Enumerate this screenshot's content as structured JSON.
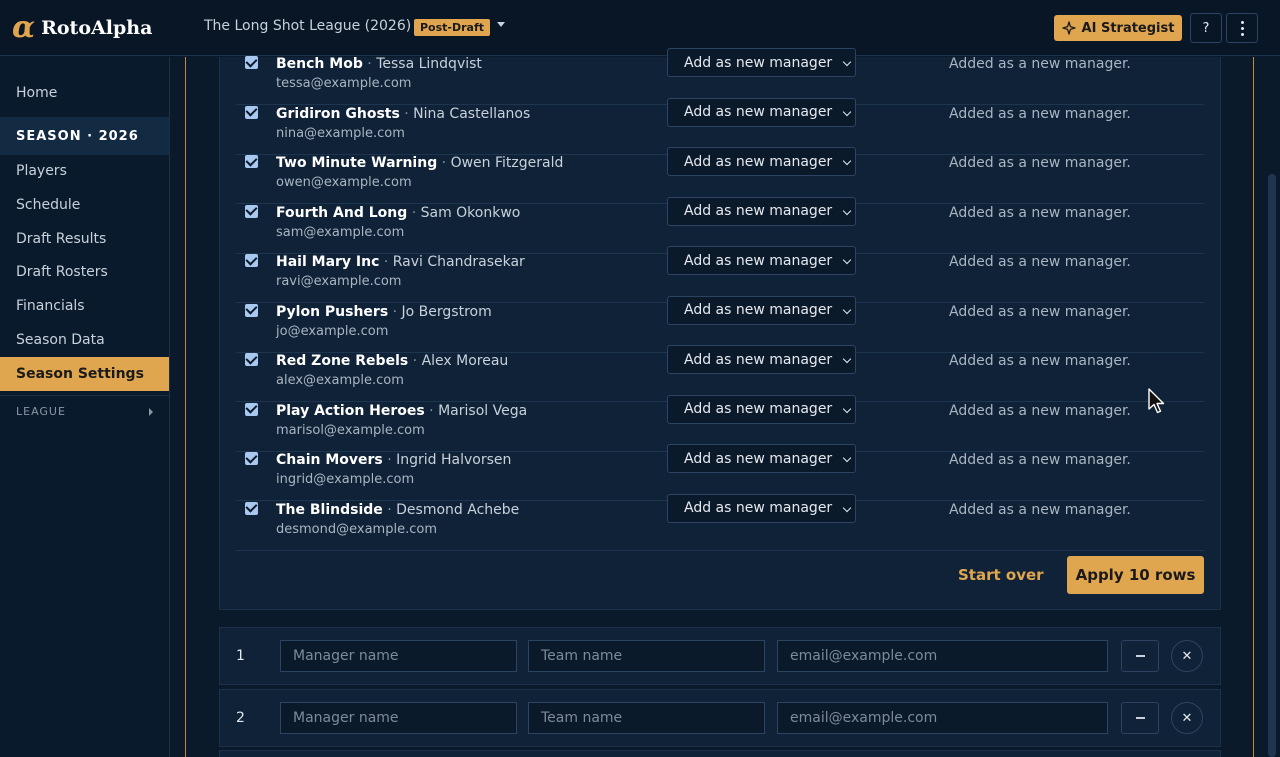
{
  "app": {
    "brand_mark": "α",
    "brand_name": "RotoAlpha"
  },
  "header": {
    "league_title": "The Long Shot League (2026)",
    "status_badge": "Post-Draft",
    "ai_button": "AI Strategist",
    "help_button": "?"
  },
  "sidebar": {
    "home": "Home",
    "season_heading": "SEASON · 2026",
    "items": [
      "Players",
      "Schedule",
      "Draft Results",
      "Draft Rosters",
      "Financials",
      "Season Data",
      "Season Settings"
    ],
    "active_item": "Season Settings",
    "league_heading": "LEAGUE"
  },
  "import_rows": [
    {
      "team": "Bench Mob",
      "manager": "Tessa Lindqvist",
      "email": "tessa@example.com",
      "action": "Add as new manager",
      "note": "Added as a new manager.",
      "checked": true
    },
    {
      "team": "Gridiron Ghosts",
      "manager": "Nina Castellanos",
      "email": "nina@example.com",
      "action": "Add as new manager",
      "note": "Added as a new manager.",
      "checked": true
    },
    {
      "team": "Two Minute Warning",
      "manager": "Owen Fitzgerald",
      "email": "owen@example.com",
      "action": "Add as new manager",
      "note": "Added as a new manager.",
      "checked": true
    },
    {
      "team": "Fourth And Long",
      "manager": "Sam Okonkwo",
      "email": "sam@example.com",
      "action": "Add as new manager",
      "note": "Added as a new manager.",
      "checked": true
    },
    {
      "team": "Hail Mary Inc",
      "manager": "Ravi Chandrasekar",
      "email": "ravi@example.com",
      "action": "Add as new manager",
      "note": "Added as a new manager.",
      "checked": true
    },
    {
      "team": "Pylon Pushers",
      "manager": "Jo Bergstrom",
      "email": "jo@example.com",
      "action": "Add as new manager",
      "note": "Added as a new manager.",
      "checked": true
    },
    {
      "team": "Red Zone Rebels",
      "manager": "Alex Moreau",
      "email": "alex@example.com",
      "action": "Add as new manager",
      "note": "Added as a new manager.",
      "checked": true
    },
    {
      "team": "Play Action Heroes",
      "manager": "Marisol Vega",
      "email": "marisol@example.com",
      "action": "Add as new manager",
      "note": "Added as a new manager.",
      "checked": true
    },
    {
      "team": "Chain Movers",
      "manager": "Ingrid Halvorsen",
      "email": "ingrid@example.com",
      "action": "Add as new manager",
      "note": "Added as a new manager.",
      "checked": true
    },
    {
      "team": "The Blindside",
      "manager": "Desmond Achebe",
      "email": "desmond@example.com",
      "action": "Add as new manager",
      "note": "Added as a new manager.",
      "checked": true
    }
  ],
  "import_actions": {
    "start_over": "Start over",
    "apply": "Apply 10 rows"
  },
  "manual_entries": [
    {
      "number": "1",
      "manager_placeholder": "Manager name",
      "team_placeholder": "Team name",
      "email_placeholder": "email@example.com"
    },
    {
      "number": "2",
      "manager_placeholder": "Manager name",
      "team_placeholder": "Team name",
      "email_placeholder": "email@example.com"
    }
  ],
  "colors": {
    "accent": "#e0a64f",
    "background": "#0b1a2b",
    "panel": "#0f2237"
  }
}
